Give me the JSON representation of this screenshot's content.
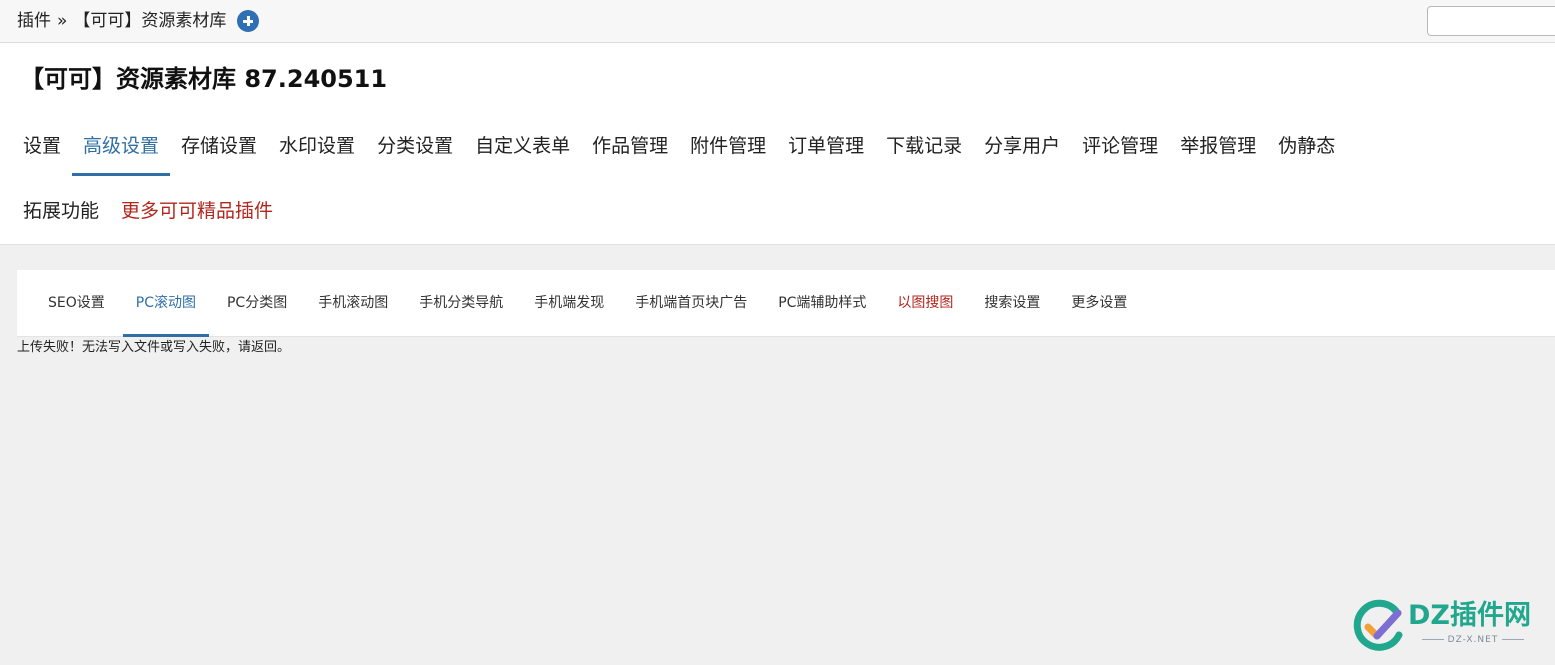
{
  "breadcrumb": {
    "root": "插件",
    "separator": "»",
    "current": "【可可】资源素材库"
  },
  "search": {
    "value": "",
    "placeholder": ""
  },
  "page_title": "【可可】资源素材库 87.240511",
  "main_nav": {
    "row1": [
      {
        "label": "设置",
        "state": "normal"
      },
      {
        "label": "高级设置",
        "state": "active"
      },
      {
        "label": "存储设置",
        "state": "normal"
      },
      {
        "label": "水印设置",
        "state": "normal"
      },
      {
        "label": "分类设置",
        "state": "normal"
      },
      {
        "label": "自定义表单",
        "state": "normal"
      },
      {
        "label": "作品管理",
        "state": "normal"
      },
      {
        "label": "附件管理",
        "state": "normal"
      },
      {
        "label": "订单管理",
        "state": "normal"
      },
      {
        "label": "下载记录",
        "state": "normal"
      },
      {
        "label": "分享用户",
        "state": "normal"
      },
      {
        "label": "评论管理",
        "state": "normal"
      },
      {
        "label": "举报管理",
        "state": "normal"
      },
      {
        "label": "伪静态",
        "state": "normal"
      }
    ],
    "row2": [
      {
        "label": "拓展功能",
        "state": "normal"
      },
      {
        "label": "更多可可精品插件",
        "state": "highlight"
      }
    ]
  },
  "sub_nav": [
    {
      "label": "SEO设置",
      "state": "normal"
    },
    {
      "label": "PC滚动图",
      "state": "active"
    },
    {
      "label": "PC分类图",
      "state": "normal"
    },
    {
      "label": "手机滚动图",
      "state": "normal"
    },
    {
      "label": "手机分类导航",
      "state": "normal"
    },
    {
      "label": "手机端发现",
      "state": "normal"
    },
    {
      "label": "手机端首页块广告",
      "state": "normal"
    },
    {
      "label": "PC端辅助样式",
      "state": "normal"
    },
    {
      "label": "以图搜图",
      "state": "highlight"
    },
    {
      "label": "搜索设置",
      "state": "normal"
    },
    {
      "label": "更多设置",
      "state": "normal"
    }
  ],
  "message": "上传失败！无法写入文件或写入失败，请返回。",
  "watermark": {
    "text": "DZ插件网",
    "sub": "DZ-X.NET"
  },
  "colors": {
    "active": "#2f6fa5",
    "highlight": "#b3261e",
    "add_icon": "#2f6fb3",
    "watermark": "#22a78f",
    "background": "#f0f0f0"
  },
  "icons": {
    "add": "plus-circle-icon",
    "watermark_logo": "check-circle-logo-icon"
  }
}
